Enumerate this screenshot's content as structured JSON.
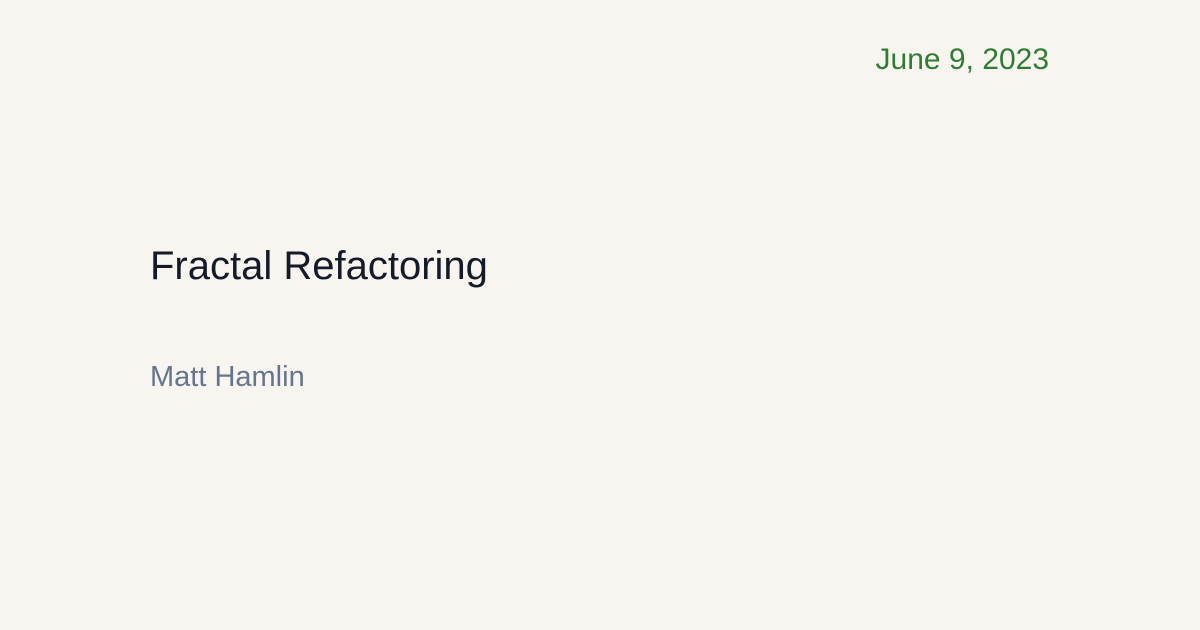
{
  "post": {
    "date": "June 9, 2023",
    "title": "Fractal Refactoring",
    "author": "Matt Hamlin"
  },
  "colors": {
    "background": "#f8f4ef",
    "date": "#2e7d32",
    "title": "#141a28",
    "author": "#66758e"
  }
}
